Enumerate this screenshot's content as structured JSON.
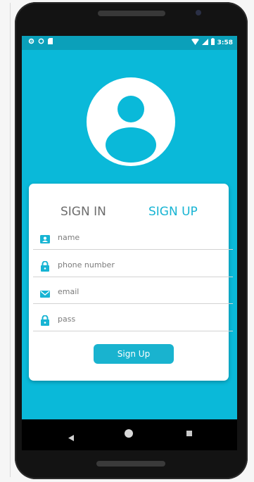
{
  "status_bar": {
    "time": "3:58",
    "left_icons": [
      "gear-icon",
      "sync-icon",
      "sd-card-icon"
    ],
    "right_icons": [
      "wifi-icon",
      "signal-icon",
      "battery-icon"
    ]
  },
  "avatar": {
    "icon": "user-avatar-icon"
  },
  "tabs": [
    {
      "label": "SIGN IN",
      "active": false
    },
    {
      "label": "SIGN UP",
      "active": true
    }
  ],
  "form": {
    "fields": [
      {
        "icon": "id-card-icon",
        "placeholder": "name"
      },
      {
        "icon": "lock-icon",
        "placeholder": "phone number"
      },
      {
        "icon": "mail-icon",
        "placeholder": "email"
      },
      {
        "icon": "lock-icon",
        "placeholder": "pass"
      }
    ],
    "submit_label": "Sign Up"
  },
  "colors": {
    "screen_bg": "#0ab9d9",
    "status_bar": "#0ba0ba",
    "accent": "#17b4d3",
    "inactive_tab": "#6d6d6d",
    "button": "#19b3cf"
  }
}
